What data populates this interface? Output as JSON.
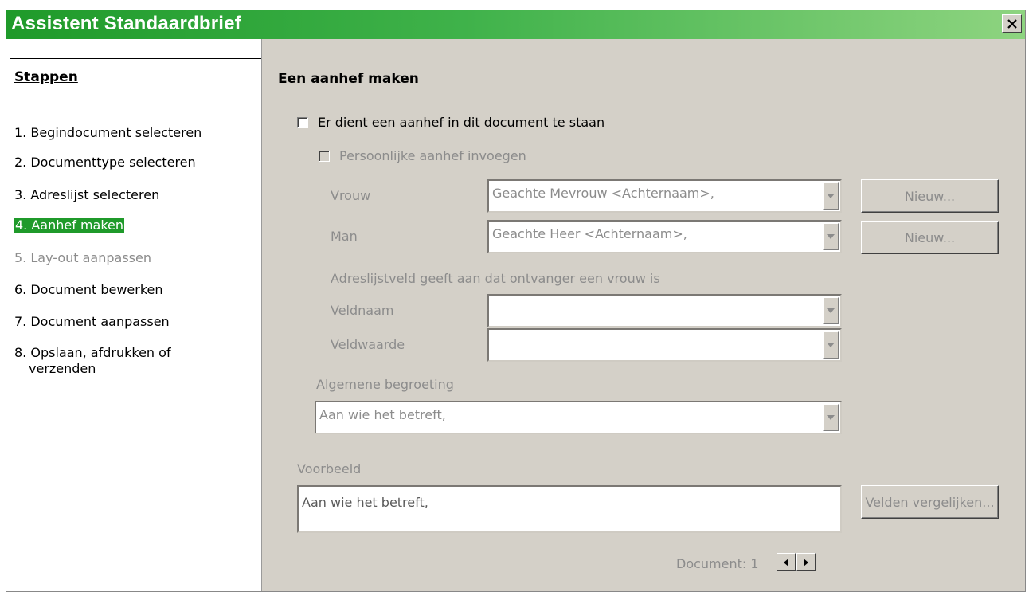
{
  "window": {
    "title": "Assistent Standaardbrief",
    "close_symbol": "×"
  },
  "steps": {
    "heading": "Stappen",
    "items": [
      {
        "label": "1. Begindocument selecteren",
        "state": "normal"
      },
      {
        "label": "2. Documenttype selecteren",
        "state": "normal"
      },
      {
        "label": "3. Adreslijst selecteren",
        "state": "normal"
      },
      {
        "label": "4. Aanhef maken",
        "state": "active"
      },
      {
        "label": "5. Lay-out aanpassen",
        "state": "disabled"
      },
      {
        "label": "6. Document bewerken",
        "state": "normal"
      },
      {
        "label": "7. Document aanpassen",
        "state": "normal"
      },
      {
        "label": "8. Opslaan, afdrukken of",
        "label2": "verzenden",
        "state": "normal"
      }
    ]
  },
  "content": {
    "heading": "Een aanhef maken",
    "salutation_checkbox": {
      "label": "Er dient een aanhef in dit document te staan",
      "checked": false
    },
    "personal_checkbox": {
      "label": "Persoonlijke aanhef invoegen",
      "checked": false,
      "enabled": false
    },
    "vrouw": {
      "label": "Vrouw",
      "value": "Geachte Mevrouw <Achternaam>,",
      "new_label": "Nieuw..."
    },
    "man": {
      "label": "Man",
      "value": "Geachte Heer <Achternaam>,",
      "new_label": "Nieuw..."
    },
    "field_caption": "Adreslijstveld geeft aan dat ontvanger een vrouw is",
    "veldnaam": {
      "label": "Veldnaam",
      "value": ""
    },
    "veldwaarde": {
      "label": "Veldwaarde",
      "value": ""
    },
    "general": {
      "label": "Algemene begroeting",
      "value": "Aan wie het betreft,"
    },
    "preview": {
      "label": "Voorbeeld",
      "value": "Aan wie het betreft,",
      "match_button": "Velden vergelijken..."
    },
    "document_nav": {
      "label": "Document: 1"
    }
  },
  "colors": {
    "accent": "#1f9a2a",
    "dialog_bg": "#d4d0c8",
    "disabled_text": "#8c8c8c"
  }
}
